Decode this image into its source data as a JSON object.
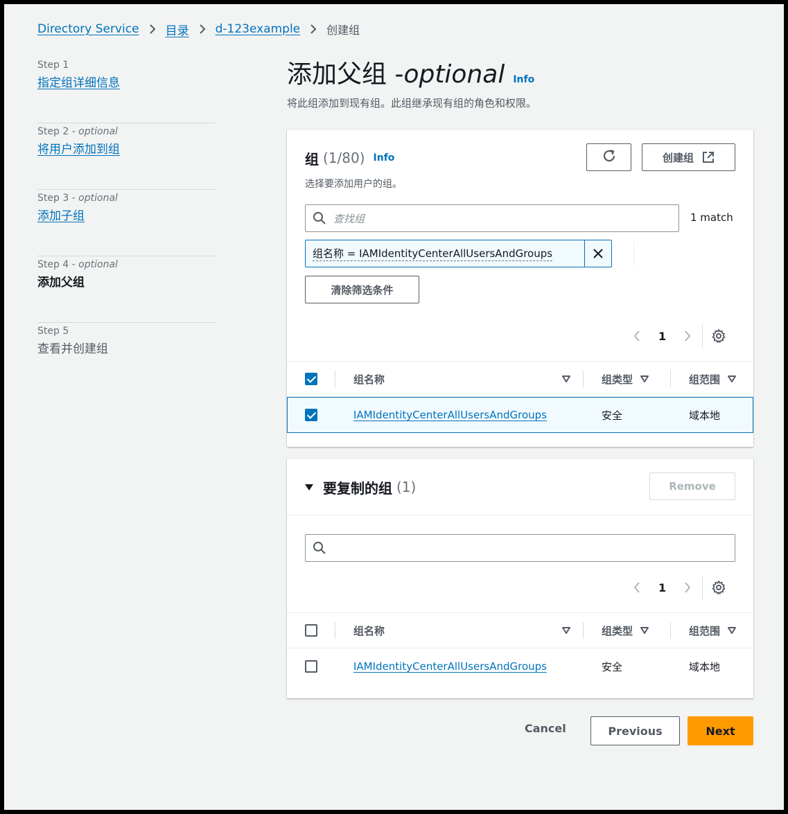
{
  "breadcrumb": {
    "items": [
      "Directory Service",
      "目录",
      "d-123example"
    ],
    "current": "创建组"
  },
  "steps": [
    {
      "num": "Step 1",
      "optional": "",
      "title": "指定组详细信息",
      "state": "link"
    },
    {
      "num": "Step 2",
      "optional": " - optional",
      "title": "将用户添加到组",
      "state": "link"
    },
    {
      "num": "Step 3",
      "optional": " - optional",
      "title": "添加子组",
      "state": "link"
    },
    {
      "num": "Step 4",
      "optional": " - optional",
      "title": "添加父组",
      "state": "active"
    },
    {
      "num": "Step 5",
      "optional": "",
      "title": "查看并创建组",
      "state": "plain"
    }
  ],
  "header": {
    "title": "添加父组 - ",
    "title_optional": "optional",
    "info": "Info",
    "description": "将此组添加到现有组。此组继承现有组的角色和权限。"
  },
  "groups_panel": {
    "title": "组",
    "count": "(1/80)",
    "info": "Info",
    "subtitle": "选择要添加用户的组。",
    "create_button": "创建组",
    "search_placeholder": "查找组",
    "match_text": "1 match",
    "filter_token": "组名称 = IAMIdentityCenterAllUsersAndGroups",
    "clear_filters": "清除筛选条件",
    "page": "1",
    "columns": [
      "组名称",
      "组类型",
      "组范围"
    ],
    "rows": [
      {
        "name": "IAMIdentityCenterAllUsersAndGroups",
        "type": "安全",
        "scope": "域本地",
        "checked": true
      }
    ]
  },
  "copy_panel": {
    "title": "要复制的组",
    "count": "(1)",
    "remove_button": "Remove",
    "search_placeholder": "",
    "page": "1",
    "columns": [
      "组名称",
      "组类型",
      "组范围"
    ],
    "rows": [
      {
        "name": "IAMIdentityCenterAllUsersAndGroups",
        "type": "安全",
        "scope": "域本地",
        "checked": false
      }
    ]
  },
  "footer": {
    "cancel": "Cancel",
    "previous": "Previous",
    "next": "Next"
  },
  "colors": {
    "link": "#0073bb",
    "primary": "#ff9900",
    "background": "#f2f3f3"
  }
}
